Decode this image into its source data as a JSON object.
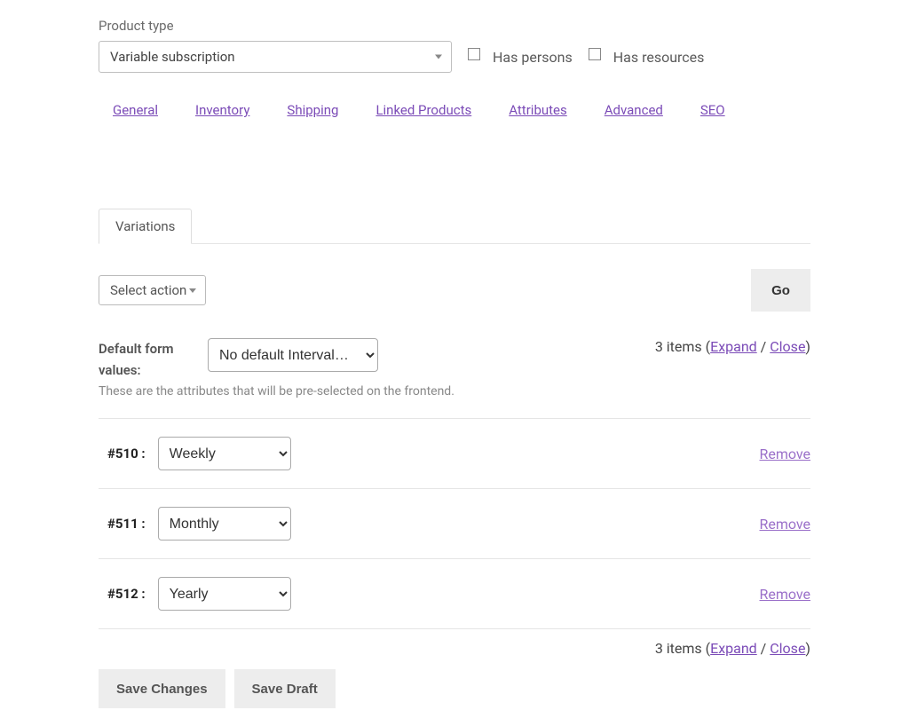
{
  "product_type": {
    "label": "Product type",
    "selected": "Variable subscription"
  },
  "checkboxes": {
    "has_persons": "Has persons",
    "has_resources": "Has resources"
  },
  "tabs": {
    "general": "General",
    "inventory": "Inventory",
    "shipping": "Shipping",
    "linked_products": "Linked Products",
    "attributes": "Attributes",
    "advanced": "Advanced",
    "seo": "SEO",
    "variations": "Variations"
  },
  "action_bar": {
    "select_action": "Select action",
    "go": "Go"
  },
  "defaults": {
    "label": "Default form values:",
    "selected": "No default Interval…",
    "help": "These are the attributes that will be pre-selected on the frontend."
  },
  "items_info": {
    "count_text": "3 items (",
    "expand": "Expand",
    "separator": " / ",
    "close": "Close",
    "closing": ")"
  },
  "variations": [
    {
      "id": "#510 :",
      "value": "Weekly"
    },
    {
      "id": "#511 :",
      "value": "Monthly"
    },
    {
      "id": "#512 :",
      "value": "Yearly"
    }
  ],
  "remove_label": "Remove",
  "buttons": {
    "save_changes": "Save Changes",
    "save_draft": "Save Draft"
  }
}
